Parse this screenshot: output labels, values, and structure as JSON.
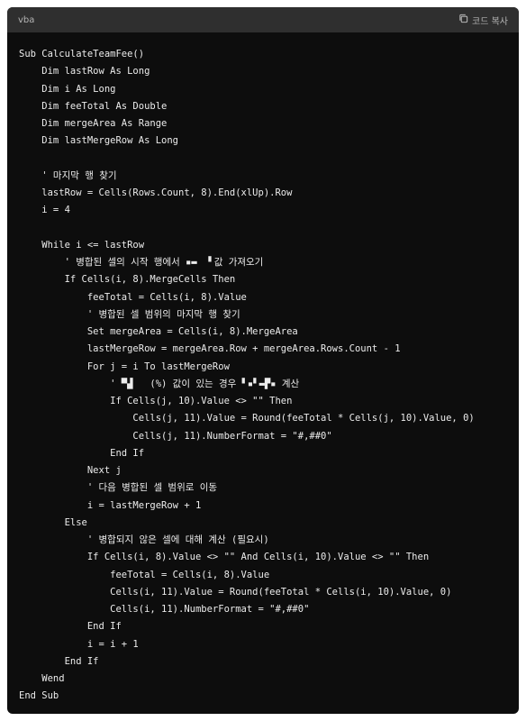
{
  "header": {
    "language": "vba",
    "copy_label": "코드 복사",
    "copy_icon": "copy-icon"
  },
  "colors": {
    "background": "#0d0d0d",
    "header": "#2f2f2f",
    "text": "#ececec",
    "muted": "#b4b4b4"
  },
  "code_lines": [
    "Sub CalculateTeamFee()",
    "    Dim lastRow As Long",
    "    Dim i As Long",
    "    Dim feeTotal As Double",
    "    Dim mergeArea As Range",
    "    Dim lastMergeRow As Long",
    "",
    "    ' 마지막 행 찾기",
    "    lastRow = Cells(Rows.Count, 8).End(xlUp).Row",
    "    i = 4",
    "",
    "    While i <= lastRow",
    "        ' 병합된 셀의 시작 행에서 ▪▬  ▘값 가져오기",
    "        If Cells(i, 8).MergeCells Then",
    "            feeTotal = Cells(i, 8).Value",
    "            ' 병합된 셀 범위의 마지막 행 찾기",
    "            Set mergeArea = Cells(i, 8).MergeArea",
    "            lastMergeRow = mergeArea.Row + mergeArea.Rows.Count - 1",
    "            For j = i To lastMergeRow",
    "                ' ▀▟   (%) 값이 있는 경우 ▘▪▘▬▛▪ 계산",
    "                If Cells(j, 10).Value <> \"\" Then",
    "                    Cells(j, 11).Value = Round(feeTotal * Cells(j, 10).Value, 0)",
    "                    Cells(j, 11).NumberFormat = \"#,##0\"",
    "                End If",
    "            Next j",
    "            ' 다음 병합된 셀 범위로 이동",
    "            i = lastMergeRow + 1",
    "        Else",
    "            ' 병합되지 않은 셀에 대해 계산 (필요시)",
    "            If Cells(i, 8).Value <> \"\" And Cells(i, 10).Value <> \"\" Then",
    "                feeTotal = Cells(i, 8).Value",
    "                Cells(i, 11).Value = Round(feeTotal * Cells(i, 10).Value, 0)",
    "                Cells(i, 11).NumberFormat = \"#,##0\"",
    "            End If",
    "            i = i + 1",
    "        End If",
    "    Wend",
    "End Sub"
  ]
}
